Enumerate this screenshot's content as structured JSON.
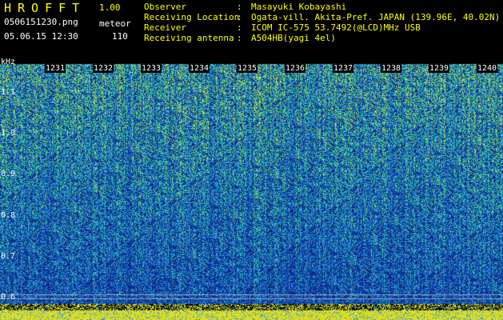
{
  "header": {
    "app_title": "HROFFT",
    "app_version": "1.00",
    "file_name": "0506151230.png",
    "mode_label": "meteor",
    "datetime": "05.06.15 12:30",
    "count": "110"
  },
  "info": [
    {
      "key": "Observer",
      "sep": ":",
      "value": "Masayuki Kobayashi"
    },
    {
      "key": "Receiving Location",
      "sep": ":",
      "value": "Ogata-vill. Akita-Pref. JAPAN (139.96E, 40.02N)"
    },
    {
      "key": "Receiver",
      "sep": ":",
      "value": "ICOM IC-575 53.7492(@LCD)MHz USB"
    },
    {
      "key": "Receiving antenna",
      "sep": ":",
      "value": "A504HB(yagi 4el)"
    }
  ],
  "spectrogram": {
    "y_unit": "kHz",
    "y_ticks": [
      {
        "label": "1.1",
        "value": 1.1
      },
      {
        "label": "1.0",
        "value": 1.0
      },
      {
        "label": "0.9",
        "value": 0.9
      },
      {
        "label": "0.8",
        "value": 0.8
      },
      {
        "label": "0.7",
        "value": 0.7
      },
      {
        "label": "0.6",
        "value": 0.6
      }
    ],
    "y_range": [
      0.585,
      1.17
    ],
    "x_ticks": [
      "1231",
      "1232",
      "1233",
      "1234",
      "1235",
      "1236",
      "1237",
      "1238",
      "1239",
      "1240"
    ],
    "colors": {
      "background": "#000000",
      "text": "#ffffff",
      "accent": "#ffff00",
      "low": "#0c1a7a",
      "mid": "#1f8fd0",
      "high": "#3ed26a"
    }
  }
}
